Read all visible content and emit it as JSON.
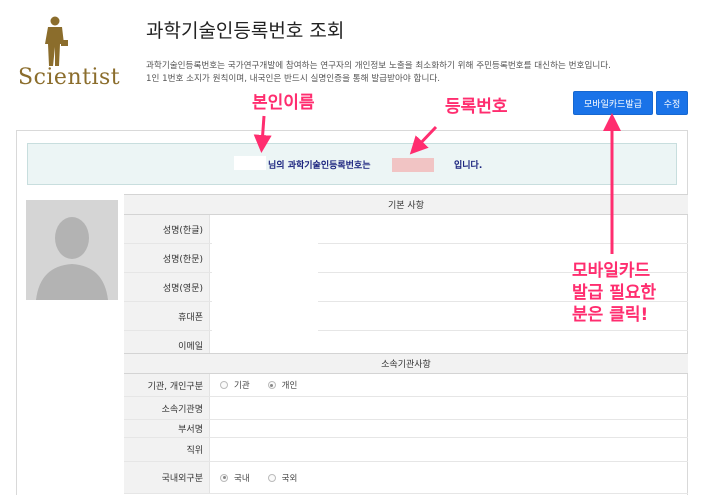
{
  "logo": {
    "text": "Scientist"
  },
  "header": {
    "title": "과학기술인등록번호 조회",
    "description_line1": "과학기술인등록번호는 국가연구개발에 참여하는 연구자의 개인정보 노출을 최소화하기 위해 주민등록번호를 대신하는 번호입니다.",
    "description_line2": "1인 1번호 소지가 원칙이며, 내국인은 반드시 실명인증을 통해 발급받아야 합니다."
  },
  "buttons": {
    "mobile_card": "모바일카드발급",
    "edit": "수정"
  },
  "annotations": {
    "name": "본인이름",
    "reg_number": "등록번호",
    "mobile_1": "모바일카드",
    "mobile_2": "발급 필요한",
    "mobile_3": "분은 클릭!"
  },
  "notice": {
    "part1": "님의 과학기술인등록번호는",
    "part2": "입니다."
  },
  "basic": {
    "header": "기본 사항",
    "rows": [
      {
        "label": "성명(한글)"
      },
      {
        "label": "성명(한문)"
      },
      {
        "label": "성명(영문)"
      },
      {
        "label": "휴대폰"
      },
      {
        "label": "이메일"
      }
    ]
  },
  "affiliation": {
    "header": "소속기관사항",
    "type_label": "기관, 개인구분",
    "type_options": [
      "기관",
      "개인"
    ],
    "type_selected": "개인",
    "org_label": "소속기관명",
    "dept_label": "부서명",
    "position_label": "직위",
    "domestic_label": "국내외구분",
    "domestic_options": [
      "국내",
      "국외"
    ],
    "domestic_selected": "국내"
  },
  "colors": {
    "accent_button": "#1a73e8",
    "annotation": "#ff2d6f",
    "logo": "#8b6d2c"
  }
}
